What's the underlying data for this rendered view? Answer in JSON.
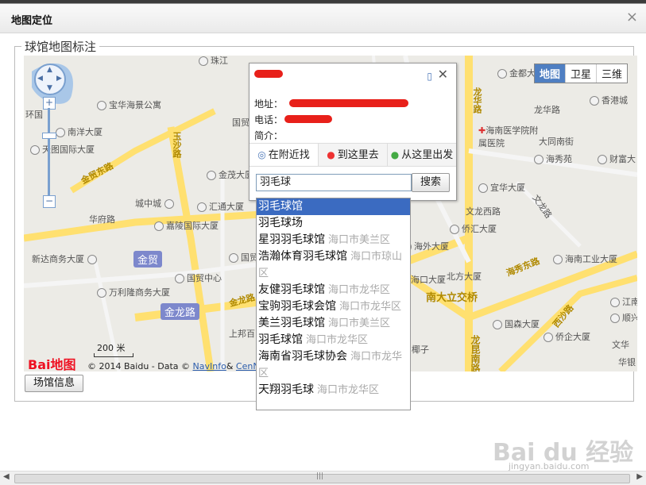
{
  "dialog": {
    "title": "地图定位",
    "close": "×"
  },
  "fieldset": {
    "legend": "球馆地图标注"
  },
  "map": {
    "type_buttons": [
      "地图",
      "卫星",
      "三维"
    ],
    "active_type": "地图",
    "zoom_in": "+",
    "zoom_out": "−",
    "labels": {
      "l1": "环国",
      "l2": "宝华海景公寓",
      "l3": "南洋大厦",
      "l4": "天图国际大厦",
      "l5": "金贸东路",
      "l6": "玉沙路",
      "l7": "国贸",
      "l8": "金茂大厦",
      "l9": "城中城",
      "l10": "华府路",
      "l11": "汇通大厦",
      "l12": "嘉陵国际大厦",
      "l13": "新达商务大厦",
      "l14": "金贸",
      "l15": "国贸大",
      "l16": "国贸中心",
      "l17": "万利隆商务大厦",
      "l18": "金龙路",
      "l19": "金龙路",
      "l20": "上邦百",
      "l21": "金都大",
      "l22": "龙华路",
      "l23": "龙华路",
      "l24": "香港城",
      "l25": "海南医学院附属医院",
      "l26": "大同南街",
      "l27": "海秀苑",
      "l28": "财富大",
      "l29": "宜华大厦",
      "l30": "文龙西路",
      "l31": "侨汇大厦",
      "l32": "文龙路",
      "l33": "海外大厦",
      "l34": "海秀东路",
      "l35": "海南工业大厦",
      "l36": "海口大厦",
      "l37": "北方大厦",
      "l38": "南大立交桥",
      "l39": "江南",
      "l40": "顺兴大",
      "l41": "国森大厦",
      "l42": "西沙路",
      "l43": "侨企大厦",
      "l44": "龙昆南路",
      "l45": "椰子",
      "l46": "文华",
      "l47": "华银",
      "l48": "珠江"
    },
    "scale": "200 米",
    "logo_text": "Bai地图",
    "copyright": {
      "prefix": "© 2014 Baidu - Data ©",
      "link1": "NavInfo",
      "amp": "&",
      "link2": "CenNavi",
      "tail": "&"
    }
  },
  "infowindow": {
    "address_label": "地址：",
    "phone_label": "电话：",
    "intro_label": "简介：",
    "tabs": [
      "在附近找",
      "到这里去",
      "从这里出发"
    ],
    "search_value": "羽毛球",
    "search_button": "搜索"
  },
  "suggestions": [
    {
      "name": "羽毛球馆",
      "area": ""
    },
    {
      "name": "羽毛球场",
      "area": ""
    },
    {
      "name": "星羽羽毛球馆",
      "area": "海口市美兰区"
    },
    {
      "name": "浩瀚体育羽毛球馆",
      "area": "海口市琼山区"
    },
    {
      "name": "友健羽毛球馆",
      "area": "海口市龙华区"
    },
    {
      "name": "宝驹羽毛球会馆",
      "area": "海口市龙华区"
    },
    {
      "name": "美兰羽毛球馆",
      "area": "海口市美兰区"
    },
    {
      "name": "羽毛球馆",
      "area": "海口市龙华区"
    },
    {
      "name": "海南省羽毛球协会",
      "area": "海口市龙华区"
    },
    {
      "name": "天翔羽毛球",
      "area": "海口市龙华区"
    }
  ],
  "footer": {
    "venue_info_button": "场馆信息"
  },
  "watermark": {
    "text": "Bai du 经验",
    "sub": "jingyan.baidu.com"
  }
}
